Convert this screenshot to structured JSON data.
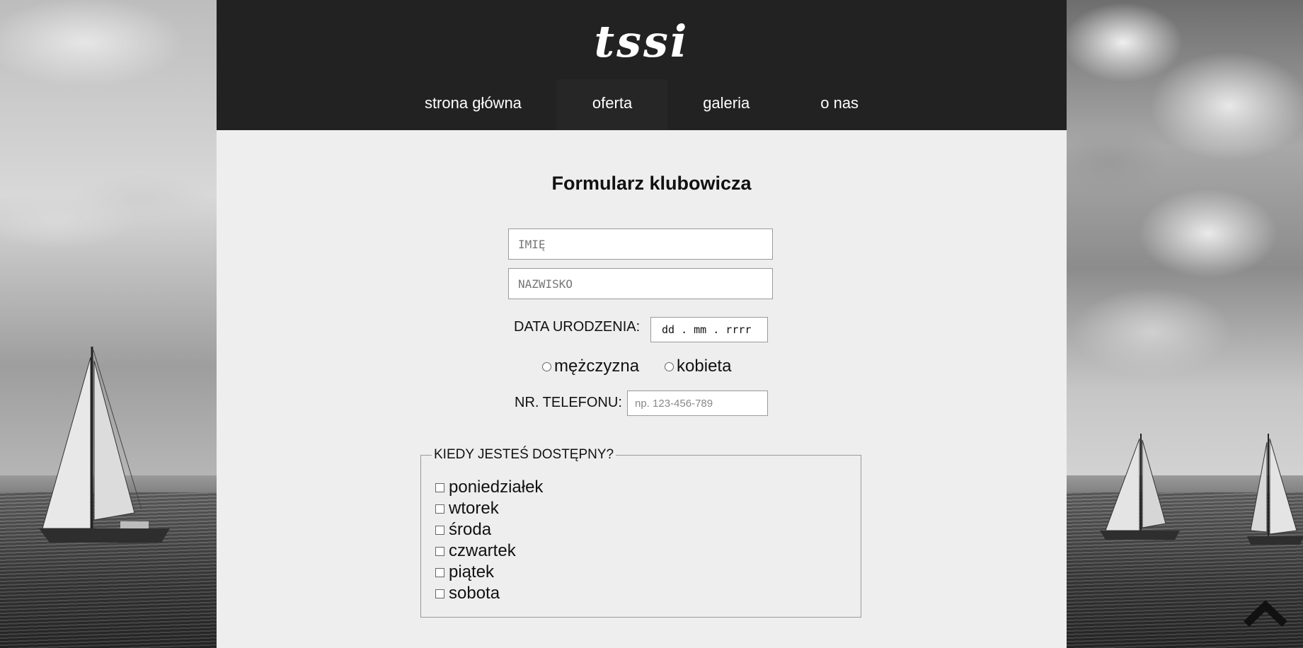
{
  "header": {
    "logo": "tssi",
    "nav": [
      {
        "label": "strona główna"
      },
      {
        "label": "oferta"
      },
      {
        "label": "galeria"
      },
      {
        "label": "o nas"
      }
    ]
  },
  "form": {
    "title": "Formularz klubowicza",
    "first_name_placeholder": "IMIĘ",
    "last_name_placeholder": "NAZWISKO",
    "dob_label": "DATA URODZENIA:",
    "dob_value": "dd . mm . rrrr",
    "gender_options": [
      {
        "label": "mężczyzna"
      },
      {
        "label": "kobieta"
      }
    ],
    "phone_label": "NR. TELEFONU:",
    "phone_placeholder": "np. 123-456-789",
    "availability_legend": "KIEDY JESTEŚ DOSTĘPNY?",
    "days": [
      {
        "label": "poniedziałek"
      },
      {
        "label": "wtorek"
      },
      {
        "label": "środa"
      },
      {
        "label": "czwartek"
      },
      {
        "label": "piątek"
      },
      {
        "label": "sobota"
      }
    ]
  },
  "icons": {
    "scroll_top": "chevron-up-icon"
  }
}
